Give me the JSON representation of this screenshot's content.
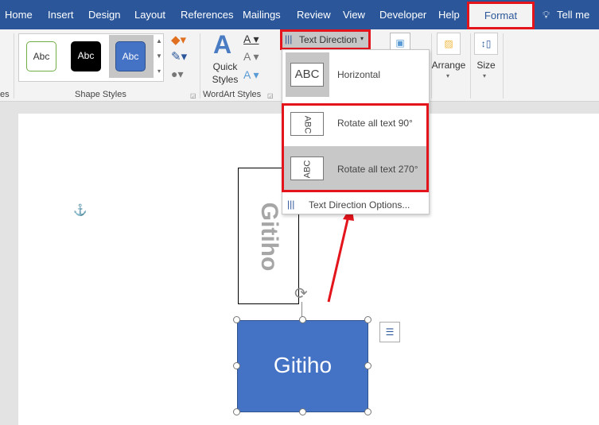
{
  "tabs": [
    "Home",
    "Insert",
    "Design",
    "Layout",
    "References",
    "Mailings",
    "Review",
    "View",
    "Developer",
    "Help",
    "Format",
    "Tell me"
  ],
  "ribbon": {
    "shape_styles": {
      "label": "Shape Styles",
      "swatches": [
        "Abc",
        "Abc",
        "Abc"
      ]
    },
    "wordart": {
      "label": "WordArt Styles",
      "quick_styles": "Quick Styles"
    },
    "text_direction": "Text Direction",
    "arrange": "Arrange",
    "size": "Size",
    "partial_group": "es"
  },
  "dropdown": {
    "items": [
      {
        "icon": "ABC",
        "label": "Horizontal"
      },
      {
        "icon": "ABC",
        "label": "Rotate all text 90°"
      },
      {
        "icon": "ABC",
        "label": "Rotate all text 270°"
      }
    ],
    "options": "Text Direction Options..."
  },
  "doc": {
    "vertical_text": "Gitiho",
    "shape_text": "Gitiho"
  },
  "colors": {
    "ribbon_blue": "#2b579a",
    "shape_fill": "#4472c4",
    "highlight": "#e3141b"
  }
}
